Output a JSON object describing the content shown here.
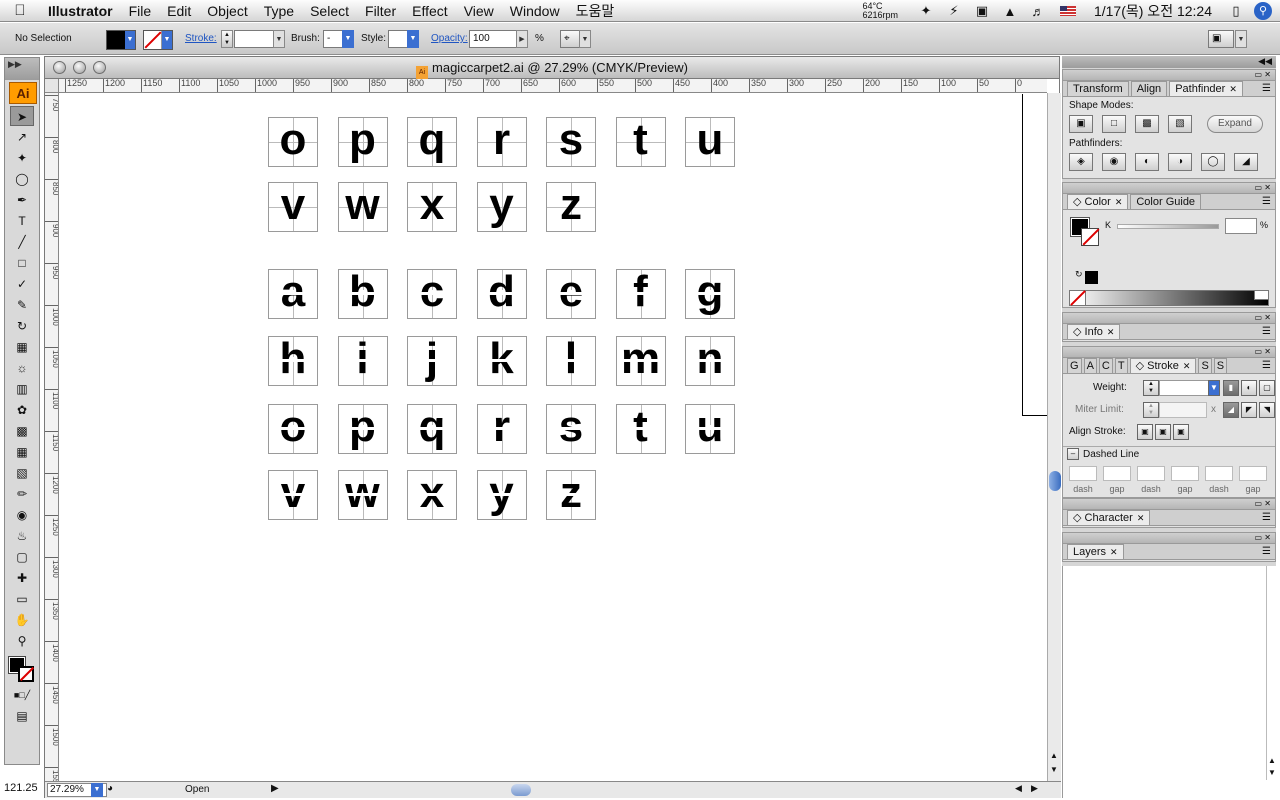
{
  "menubar": {
    "app": "Illustrator",
    "items": [
      "File",
      "Edit",
      "Object",
      "Type",
      "Select",
      "Filter",
      "Effect",
      "View",
      "Window",
      "도움말"
    ],
    "temp": "64°C",
    "rpm": "6216rpm",
    "clock": "1/17(목) 오전 12:24"
  },
  "control": {
    "selection": "No Selection",
    "stroke_label": "Stroke:",
    "brush_label": "Brush:",
    "brush_value": "-",
    "style_label": "Style:",
    "opacity_label": "Opacity:",
    "opacity_value": "100",
    "percent": "%"
  },
  "tools": {
    "logo": "Ai",
    "icons": [
      "selection-tool",
      "direct-selection-tool",
      "magic-wand-tool",
      "lasso-tool",
      "pen-tool",
      "type-tool",
      "line-tool",
      "rectangle-tool",
      "paintbrush-tool",
      "pencil-tool",
      "rotate-tool",
      "scale-tool",
      "warp-tool",
      "free-transform-tool",
      "symbol-sprayer-tool",
      "graph-tool",
      "mesh-tool",
      "gradient-tool",
      "eyedropper-tool",
      "blend-tool",
      "live-paint-tool",
      "live-paint-selection-tool",
      "slice-tool",
      "eraser-tool",
      "hand-tool",
      "zoom-tool"
    ]
  },
  "document": {
    "title": "magiccarpet2.ai @ 27.29% (CMYK/Preview)",
    "file_badge": "Ai",
    "ruler_h": [
      "1250",
      "1200",
      "1150",
      "1100",
      "1050",
      "1000",
      "950",
      "900",
      "850",
      "800",
      "750",
      "700",
      "650",
      "600",
      "550",
      "500",
      "450",
      "400",
      "350",
      "300",
      "250",
      "200",
      "150",
      "100",
      "50",
      "0"
    ],
    "ruler_v": [
      "750",
      "800",
      "850",
      "900",
      "950",
      "1000",
      "1050",
      "1100",
      "1150",
      "1200",
      "1250",
      "1300",
      "1350",
      "1400",
      "1450",
      "1500",
      "1550"
    ],
    "glyph_rows": [
      [
        "o",
        "p",
        "q",
        "r",
        "s",
        "t",
        "u"
      ],
      [
        "v",
        "w",
        "x",
        "y",
        "z"
      ],
      [
        "a",
        "b",
        "c",
        "d",
        "e",
        "f",
        "g"
      ],
      [
        "h",
        "i",
        "j",
        "k",
        "l",
        "m",
        "n"
      ],
      [
        "o",
        "p",
        "q",
        "r",
        "s",
        "t",
        "u"
      ],
      [
        "v",
        "w",
        "x",
        "y",
        "z"
      ]
    ],
    "zoom": "27.29%",
    "status": "Open",
    "coord": "121.25"
  },
  "panels": {
    "transform_tabs": [
      "Transform",
      "Align",
      "Pathfinder"
    ],
    "shape_modes": "Shape Modes:",
    "expand": "Expand",
    "pathfinders": "Pathfinders:",
    "color_tabs": [
      "Color",
      "Color Guide"
    ],
    "k_label": "K",
    "k_pct": "%",
    "info_tab": "Info",
    "stroke_tab": "Stroke",
    "stroke_other_tabs": [
      "G",
      "A",
      "C",
      "T"
    ],
    "stroke_suffix_tabs": [
      "S",
      "S"
    ],
    "weight": "Weight:",
    "miter": "Miter Limit:",
    "miter_x": "x",
    "align_stroke": "Align Stroke:",
    "dashed_line": "Dashed Line",
    "dash_labels": [
      "dash",
      "gap",
      "dash",
      "gap",
      "dash",
      "gap"
    ],
    "character_tab": "Character",
    "layers_tab": "Layers"
  }
}
